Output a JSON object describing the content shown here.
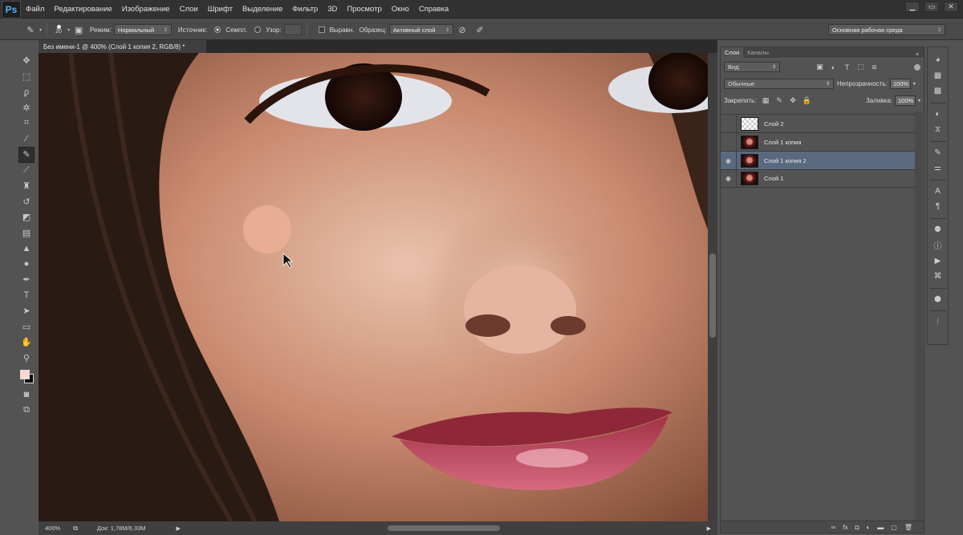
{
  "app": {
    "logo": "Ps"
  },
  "menu": [
    "Файл",
    "Редактирование",
    "Изображение",
    "Слои",
    "Шрифт",
    "Выделение",
    "Фильтр",
    "3D",
    "Просмотр",
    "Окно",
    "Справка"
  ],
  "window_controls": {
    "minimize": "▁",
    "maximize": "▭",
    "close": "✕"
  },
  "options": {
    "brush_size": "20",
    "mode_label": "Режим:",
    "mode_value": "Нормальный",
    "source_label": "Источник:",
    "sampled_label": "Семпл.",
    "pattern_label": "Узор:",
    "aligned_label": "Выравн.",
    "sample_label": "Образец:",
    "sample_value": "Активный слой",
    "workspace": "Основная рабочая среда"
  },
  "document": {
    "tab_title": "Без имени-1 @ 400% (Слой 1 копия 2, RGB/8) *",
    "zoom": "400%",
    "doc_info": "Док: 1,78M/6,33M"
  },
  "tools": [
    "move-tool",
    "marquee-tool",
    "lasso-tool",
    "magic-wand-tool",
    "crop-tool",
    "eyedropper-tool",
    "healing-brush-tool",
    "brush-tool",
    "clone-stamp-tool",
    "history-brush-tool",
    "eraser-tool",
    "gradient-tool",
    "blur-tool",
    "dodge-tool",
    "pen-tool",
    "type-tool",
    "path-selection-tool",
    "shape-tool",
    "hand-tool",
    "zoom-tool"
  ],
  "active_tool": "healing-brush-tool",
  "colors": {
    "foreground": "#f6d9d0",
    "background": "#000000",
    "selected_layer": "#59697f"
  },
  "layers_panel": {
    "tabs": [
      "Слои",
      "Каналы"
    ],
    "filter_label": "Вид",
    "blend_mode": "Обычные",
    "opacity_label": "Непрозрачность:",
    "opacity_value": "100%",
    "lock_label": "Закрепить:",
    "fill_label": "Заливка:",
    "fill_value": "100%",
    "layers": [
      {
        "name": "Слой 2",
        "visible": false,
        "thumb": "transparent",
        "selected": false
      },
      {
        "name": "Слой 1 копия",
        "visible": false,
        "thumb": "portrait",
        "selected": false
      },
      {
        "name": "Слой 1 копия 2",
        "visible": true,
        "thumb": "portrait",
        "selected": true
      },
      {
        "name": "Слой 1",
        "visible": true,
        "thumb": "portrait",
        "selected": false
      }
    ]
  }
}
